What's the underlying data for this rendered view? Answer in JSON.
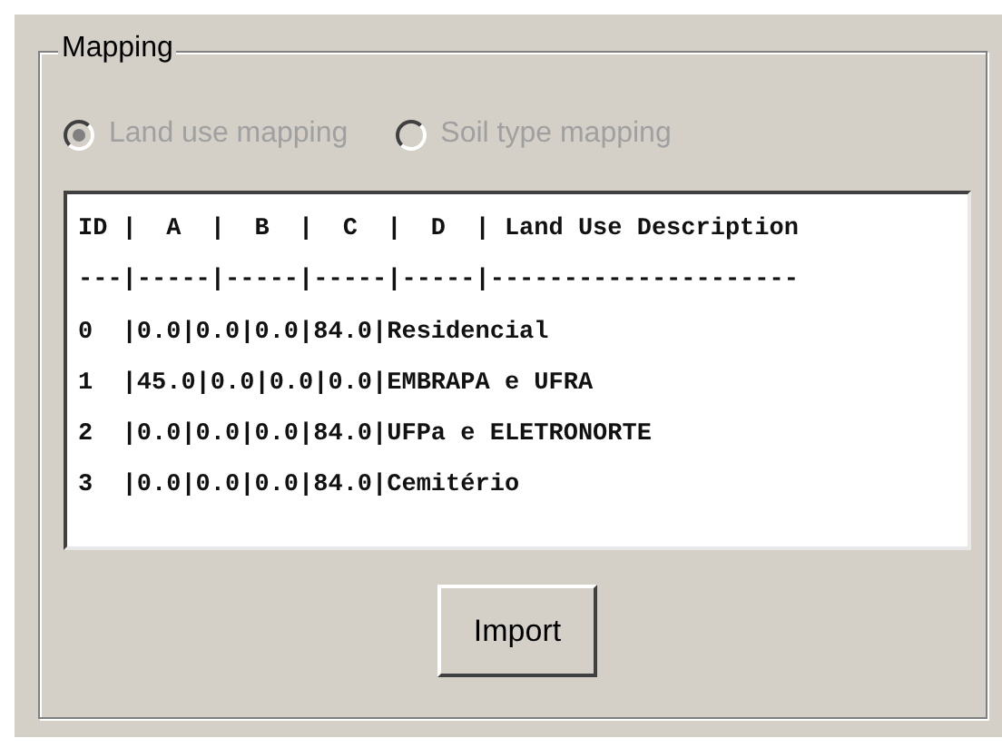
{
  "group": {
    "title": "Mapping"
  },
  "radios": [
    {
      "label": "Land use mapping",
      "selected": true,
      "disabled": true
    },
    {
      "label": "Soil type mapping",
      "selected": false,
      "disabled": true
    }
  ],
  "text_lines": [
    "ID |  A  |  B  |  C  |  D  | Land Use Description",
    "---|-----|-----|-----|-----|---------------------",
    "0  |0.0|0.0|0.0|84.0|Residencial",
    "1  |45.0|0.0|0.0|0.0|EMBRAPA e UFRA",
    "2  |0.0|0.0|0.0|84.0|UFPa e ELETRONORTE",
    "3  |0.0|0.0|0.0|84.0|Cemitério"
  ],
  "buttons": [
    {
      "label": "Import"
    }
  ]
}
